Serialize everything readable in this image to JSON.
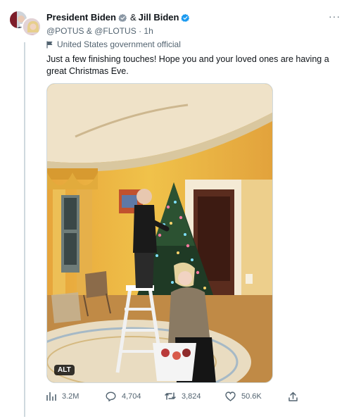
{
  "tweet": {
    "author_primary": "President Biden",
    "author_secondary": "Jill Biden",
    "ampersand": "&",
    "handles": "@POTUS & @FLOTUS",
    "time": "· 1h",
    "more_label": "···",
    "account_label": "United States government official",
    "text": "Just a few finishing touches! Hope you and your loved ones are having a great Christmas Eve.",
    "alt_badge": "ALT",
    "badge_color": "#1d9bf0",
    "muted_color": "#536471"
  },
  "actions": {
    "views": "3.2M",
    "replies": "4,704",
    "retweets": "3,824",
    "likes": "50.6K"
  },
  "icons": [
    "verified-badge-icon",
    "more-icon",
    "flag-icon",
    "views-icon",
    "reply-icon",
    "retweet-icon",
    "like-icon",
    "share-icon"
  ]
}
